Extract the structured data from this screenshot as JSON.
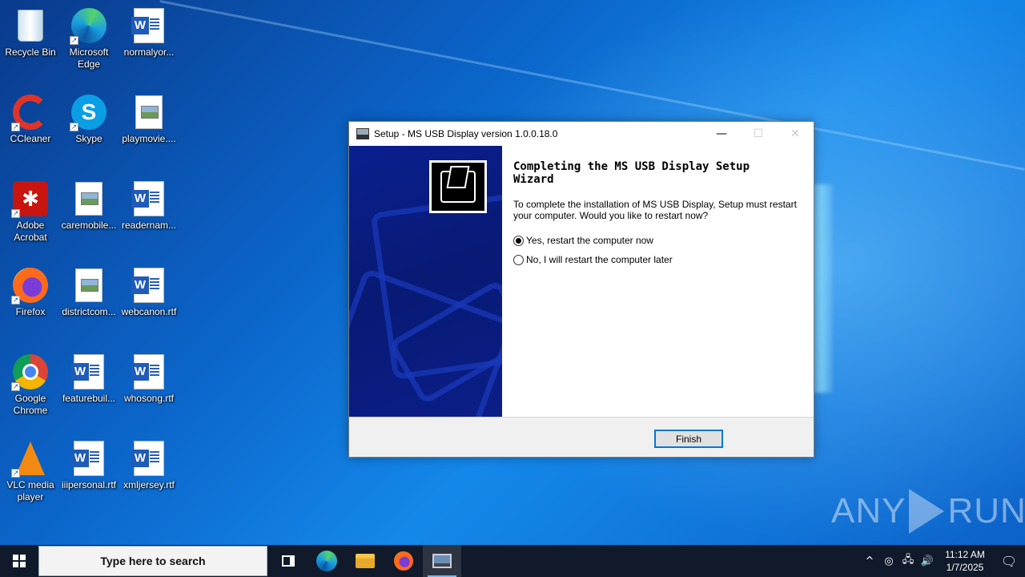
{
  "desktop": {
    "icons": [
      {
        "label": "Recycle Bin",
        "icon": "recycle-bin-icon"
      },
      {
        "label": "Microsoft Edge",
        "icon": "edge-icon"
      },
      {
        "label": "normalyor...",
        "icon": "word-doc-icon"
      },
      {
        "label": "CCleaner",
        "icon": "ccleaner-icon"
      },
      {
        "label": "Skype",
        "icon": "skype-icon"
      },
      {
        "label": "playmovie....",
        "icon": "image-file-icon"
      },
      {
        "label": "Adobe Acrobat",
        "icon": "acrobat-icon"
      },
      {
        "label": "caremobile...",
        "icon": "image-file-icon"
      },
      {
        "label": "readernam...",
        "icon": "word-doc-icon"
      },
      {
        "label": "Firefox",
        "icon": "firefox-icon"
      },
      {
        "label": "districtcom...",
        "icon": "image-file-icon"
      },
      {
        "label": "webcanon.rtf",
        "icon": "word-doc-icon"
      },
      {
        "label": "Google Chrome",
        "icon": "chrome-icon"
      },
      {
        "label": "featurebuil...",
        "icon": "word-doc-icon"
      },
      {
        "label": "whosong.rtf",
        "icon": "word-doc-icon"
      },
      {
        "label": "VLC media player",
        "icon": "vlc-icon"
      },
      {
        "label": "iiipersonal.rtf",
        "icon": "word-doc-icon"
      },
      {
        "label": "xmljersey.rtf",
        "icon": "word-doc-icon"
      }
    ]
  },
  "dialog": {
    "title": "Setup - MS USB Display version 1.0.0.18.0",
    "heading_line1": "Completing the MS USB Display Setup",
    "heading_line2": "Wizard",
    "body": "To complete the installation of MS USB Display, Setup must restart your computer. Would you like to restart now?",
    "option_yes": "Yes, restart the computer now",
    "option_no": "No, I will restart the computer later",
    "selected_option": "yes",
    "finish_label": "Finish",
    "minimize_glyph": "—",
    "maximize_glyph": "☐",
    "close_glyph": "✕"
  },
  "watermark": {
    "left": "ANY",
    "right": "RUN"
  },
  "taskbar": {
    "search_placeholder": "Type here to search",
    "apps": [
      "task-view-icon",
      "edge-icon",
      "file-explorer-icon",
      "firefox-icon",
      "setup-app-icon"
    ],
    "tray": {
      "chevron": "^",
      "time": "11:12 AM",
      "date": "1/7/2025"
    }
  }
}
